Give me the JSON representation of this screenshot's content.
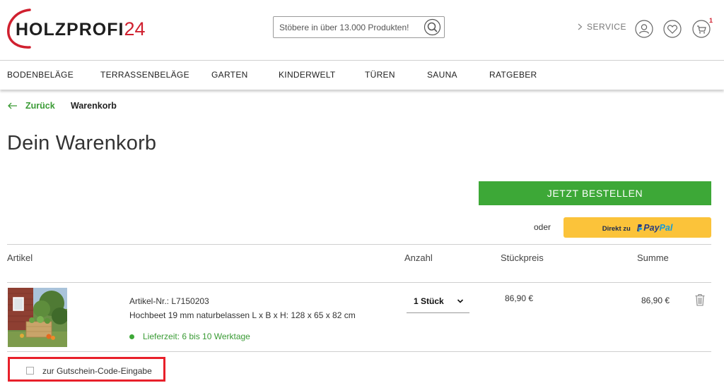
{
  "header": {
    "logo_brand": "HOLZPROFI",
    "logo_number": "24",
    "search_placeholder": "Stöbere in über 13.000 Produkten!",
    "service_label": "SERVICE",
    "cart_count": "1",
    "icons": [
      "search-icon",
      "chevron-right-icon",
      "account-icon",
      "wishlist-heart-icon",
      "cart-icon"
    ]
  },
  "nav": {
    "items": [
      "BODENBELÄGE",
      "TERRASSENBELÄGE",
      "GARTEN",
      "KINDERWELT",
      "TÜREN",
      "SAUNA",
      "RATGEBER"
    ]
  },
  "breadcrumb": {
    "back_label": "Zurück",
    "current": "Warenkorb"
  },
  "page_title": "Dein Warenkorb",
  "actions": {
    "order_label": "JETZT BESTELLEN",
    "or_label": "oder",
    "paypal_prefix": "Direkt zu",
    "paypal_pay": "Pay",
    "paypal_pal": "Pal"
  },
  "table": {
    "headers": {
      "article": "Artikel",
      "quantity": "Anzahl",
      "unit_price": "Stückpreis",
      "sum": "Summe"
    },
    "items": [
      {
        "article_no": "Artikel-Nr.: L7150203",
        "name": "Hochbeet 19 mm naturbelassen L x B x H: 128 x 65 x 82 cm",
        "delivery": "Lieferzeit: 6 bis 10 Werktage",
        "quantity": "1 Stück",
        "unit_price": "86,90 €",
        "sum": "86,90 €"
      }
    ]
  },
  "voucher": {
    "label": "zur Gutschein-Code-Eingabe",
    "checked": false
  },
  "colors": {
    "brand_red": "#d0202f",
    "accent_green": "#3da837",
    "paypal_yellow": "#fbc33a",
    "highlight_red": "#e8202a"
  }
}
